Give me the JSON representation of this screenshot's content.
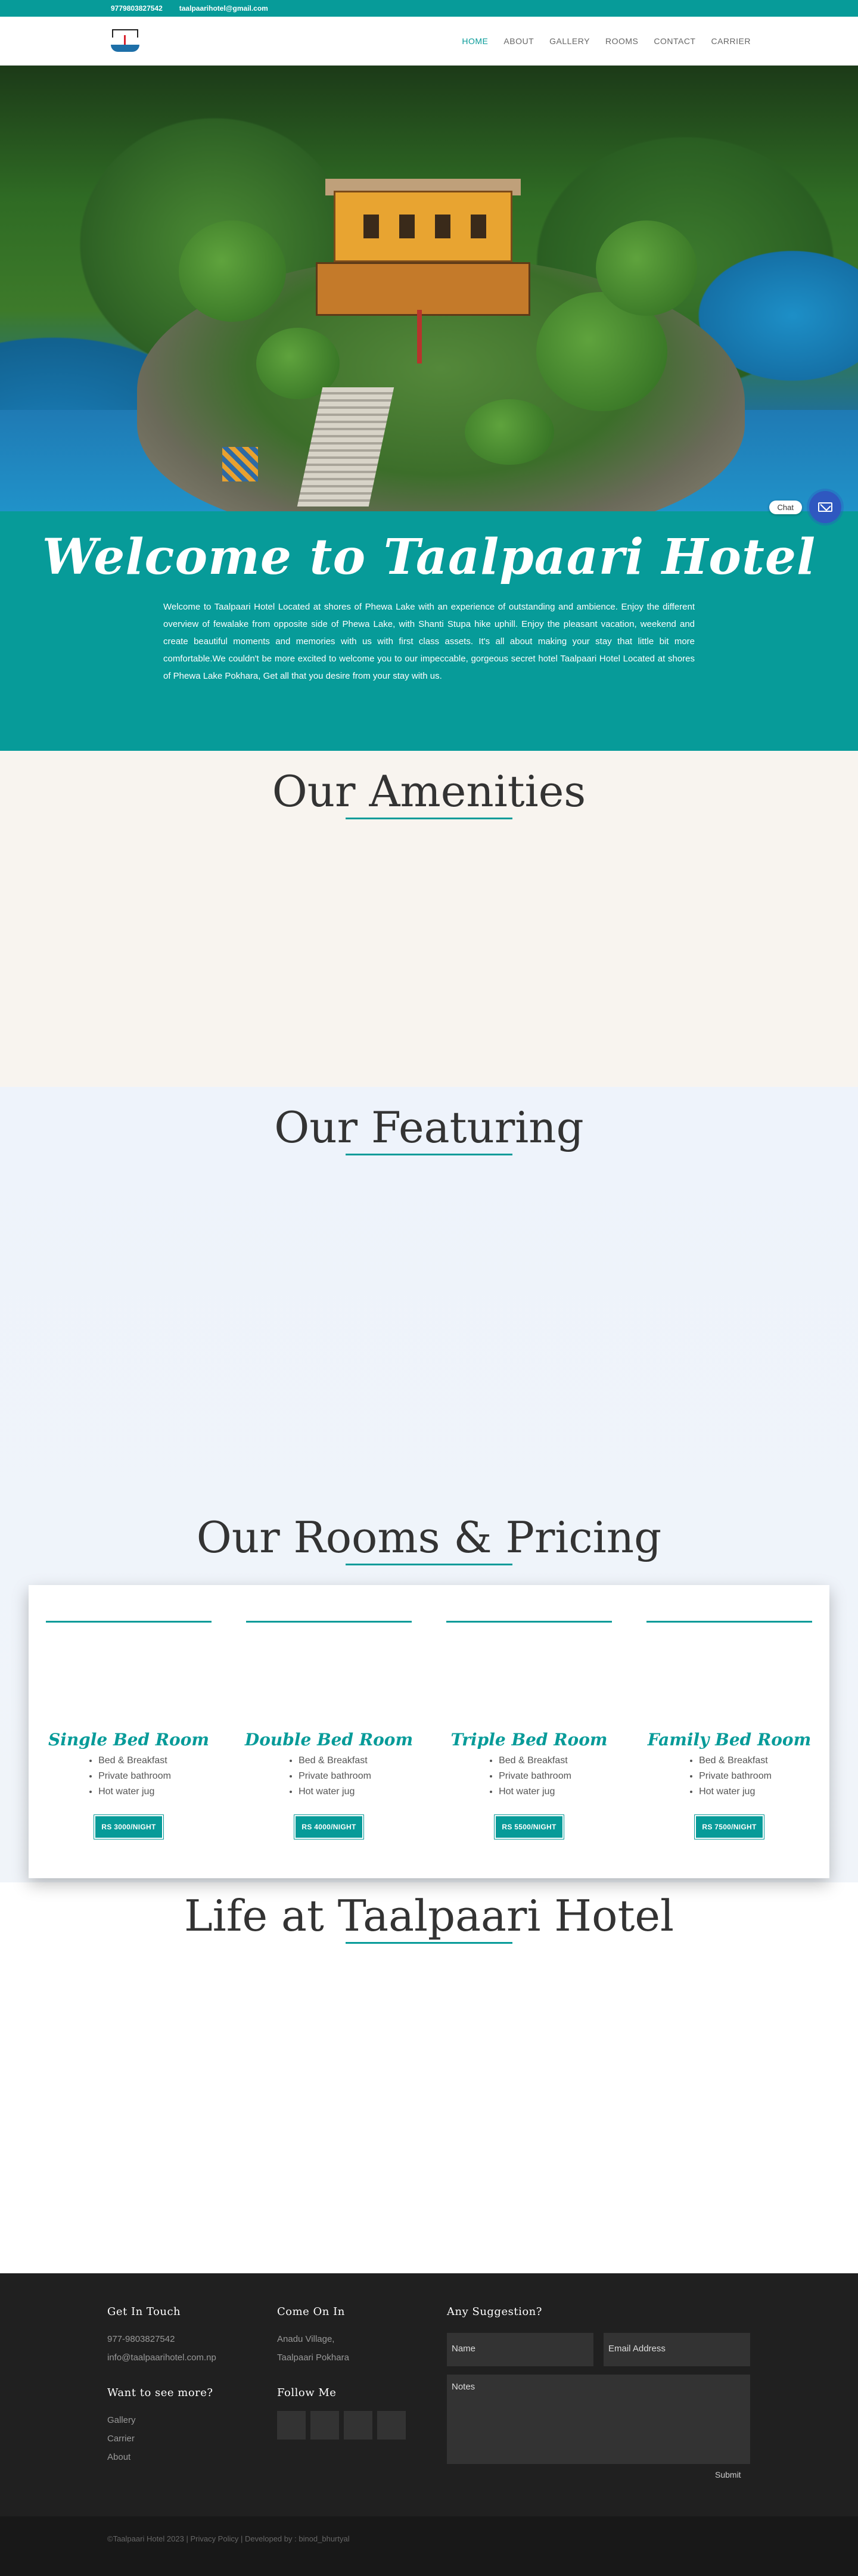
{
  "topbar": {
    "phone": "9779803827542",
    "email": "taalpaarihotel@gmail.com"
  },
  "nav": {
    "items": [
      "HOME",
      "ABOUT",
      "GALLERY",
      "ROOMS",
      "CONTACT",
      "CARRIER"
    ],
    "active": "HOME"
  },
  "chat": {
    "label": "Chat",
    "icon": "mail-icon"
  },
  "welcome": {
    "title": "Welcome to Taalpaari Hotel",
    "body": "Welcome to Taalpaari Hotel Located at shores of Phewa Lake with an experience of outstanding and ambience. Enjoy the different overview of fewalake from opposite side of Phewa Lake, with Shanti Stupa hike uphill. Enjoy the pleasant vacation, weekend and create beautiful moments and memories with us with first class assets. It's all about making your stay that little bit more comfortable.We couldn't be more excited to welcome you to our impeccable, gorgeous secret hotel Taalpaari Hotel Located at shores of Phewa Lake Pokhara, Get all that you desire from your stay with us."
  },
  "amenities": {
    "title": "Our Amenities"
  },
  "featuring": {
    "title": "Our Featuring"
  },
  "rooms": {
    "title": "Our Rooms & Pricing",
    "items": [
      {
        "name": "Single Bed Room",
        "features": [
          "Bed & Breakfast",
          "Private bathroom",
          "Hot water jug"
        ],
        "price": "RS 3000/NIGHT"
      },
      {
        "name": "Double Bed Room",
        "features": [
          "Bed & Breakfast",
          "Private bathroom",
          "Hot water jug"
        ],
        "price": "RS 4000/NIGHT"
      },
      {
        "name": "Triple Bed Room",
        "features": [
          "Bed & Breakfast",
          "Private bathroom",
          "Hot water jug"
        ],
        "price": "RS 5500/NIGHT"
      },
      {
        "name": "Family Bed Room",
        "features": [
          "Bed & Breakfast",
          "Private bathroom",
          "Hot water jug"
        ],
        "price": "RS 7500/NIGHT"
      }
    ]
  },
  "life": {
    "title": "Life at Taalpaari Hotel"
  },
  "footer": {
    "get_in_touch": {
      "title": "Get In Touch",
      "phone": "977-9803827542",
      "email": "info@taalpaarihotel.com.np"
    },
    "come_on_in": {
      "title": "Come On In",
      "line1": "Anadu Village,",
      "line2": "Taalpaari Pokhara"
    },
    "see_more": {
      "title": "Want to see more?",
      "links": [
        "Gallery",
        "Carrier",
        "About"
      ]
    },
    "follow": {
      "title": "Follow Me"
    },
    "suggestion": {
      "title": "Any Suggestion?",
      "name_placeholder": "Name",
      "email_placeholder": "Email Address",
      "notes_placeholder": "Notes",
      "submit": "Submit"
    }
  },
  "copyright": {
    "text": "©Taalpaari Hotel 2023",
    "privacy": "Privacy Policy",
    "developer": "Developed by : binod_bhurtyal"
  },
  "colors": {
    "accent": "#079b99",
    "footer": "#202020"
  }
}
